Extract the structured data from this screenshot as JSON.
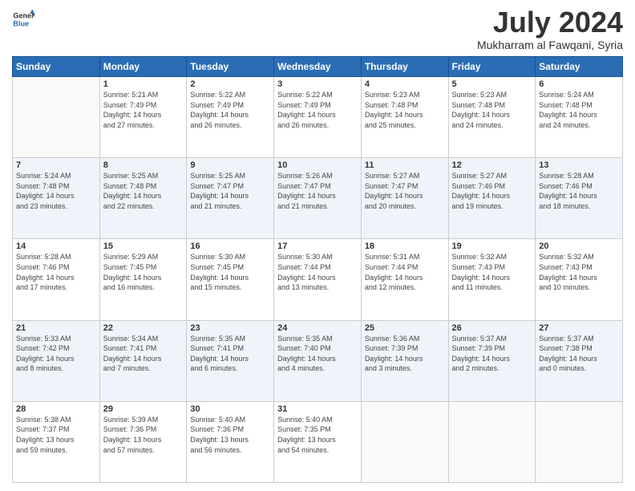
{
  "header": {
    "logo_line1": "General",
    "logo_line2": "Blue",
    "title": "July 2024",
    "subtitle": "Mukharram al Fawqani, Syria"
  },
  "weekdays": [
    "Sunday",
    "Monday",
    "Tuesday",
    "Wednesday",
    "Thursday",
    "Friday",
    "Saturday"
  ],
  "weeks": [
    [
      {
        "day": "",
        "info": ""
      },
      {
        "day": "1",
        "info": "Sunrise: 5:21 AM\nSunset: 7:49 PM\nDaylight: 14 hours\nand 27 minutes."
      },
      {
        "day": "2",
        "info": "Sunrise: 5:22 AM\nSunset: 7:49 PM\nDaylight: 14 hours\nand 26 minutes."
      },
      {
        "day": "3",
        "info": "Sunrise: 5:22 AM\nSunset: 7:49 PM\nDaylight: 14 hours\nand 26 minutes."
      },
      {
        "day": "4",
        "info": "Sunrise: 5:23 AM\nSunset: 7:48 PM\nDaylight: 14 hours\nand 25 minutes."
      },
      {
        "day": "5",
        "info": "Sunrise: 5:23 AM\nSunset: 7:48 PM\nDaylight: 14 hours\nand 24 minutes."
      },
      {
        "day": "6",
        "info": "Sunrise: 5:24 AM\nSunset: 7:48 PM\nDaylight: 14 hours\nand 24 minutes."
      }
    ],
    [
      {
        "day": "7",
        "info": "Sunrise: 5:24 AM\nSunset: 7:48 PM\nDaylight: 14 hours\nand 23 minutes."
      },
      {
        "day": "8",
        "info": "Sunrise: 5:25 AM\nSunset: 7:48 PM\nDaylight: 14 hours\nand 22 minutes."
      },
      {
        "day": "9",
        "info": "Sunrise: 5:25 AM\nSunset: 7:47 PM\nDaylight: 14 hours\nand 21 minutes."
      },
      {
        "day": "10",
        "info": "Sunrise: 5:26 AM\nSunset: 7:47 PM\nDaylight: 14 hours\nand 21 minutes."
      },
      {
        "day": "11",
        "info": "Sunrise: 5:27 AM\nSunset: 7:47 PM\nDaylight: 14 hours\nand 20 minutes."
      },
      {
        "day": "12",
        "info": "Sunrise: 5:27 AM\nSunset: 7:46 PM\nDaylight: 14 hours\nand 19 minutes."
      },
      {
        "day": "13",
        "info": "Sunrise: 5:28 AM\nSunset: 7:46 PM\nDaylight: 14 hours\nand 18 minutes."
      }
    ],
    [
      {
        "day": "14",
        "info": "Sunrise: 5:28 AM\nSunset: 7:46 PM\nDaylight: 14 hours\nand 17 minutes."
      },
      {
        "day": "15",
        "info": "Sunrise: 5:29 AM\nSunset: 7:45 PM\nDaylight: 14 hours\nand 16 minutes."
      },
      {
        "day": "16",
        "info": "Sunrise: 5:30 AM\nSunset: 7:45 PM\nDaylight: 14 hours\nand 15 minutes."
      },
      {
        "day": "17",
        "info": "Sunrise: 5:30 AM\nSunset: 7:44 PM\nDaylight: 14 hours\nand 13 minutes."
      },
      {
        "day": "18",
        "info": "Sunrise: 5:31 AM\nSunset: 7:44 PM\nDaylight: 14 hours\nand 12 minutes."
      },
      {
        "day": "19",
        "info": "Sunrise: 5:32 AM\nSunset: 7:43 PM\nDaylight: 14 hours\nand 11 minutes."
      },
      {
        "day": "20",
        "info": "Sunrise: 5:32 AM\nSunset: 7:43 PM\nDaylight: 14 hours\nand 10 minutes."
      }
    ],
    [
      {
        "day": "21",
        "info": "Sunrise: 5:33 AM\nSunset: 7:42 PM\nDaylight: 14 hours\nand 8 minutes."
      },
      {
        "day": "22",
        "info": "Sunrise: 5:34 AM\nSunset: 7:41 PM\nDaylight: 14 hours\nand 7 minutes."
      },
      {
        "day": "23",
        "info": "Sunrise: 5:35 AM\nSunset: 7:41 PM\nDaylight: 14 hours\nand 6 minutes."
      },
      {
        "day": "24",
        "info": "Sunrise: 5:35 AM\nSunset: 7:40 PM\nDaylight: 14 hours\nand 4 minutes."
      },
      {
        "day": "25",
        "info": "Sunrise: 5:36 AM\nSunset: 7:39 PM\nDaylight: 14 hours\nand 3 minutes."
      },
      {
        "day": "26",
        "info": "Sunrise: 5:37 AM\nSunset: 7:39 PM\nDaylight: 14 hours\nand 2 minutes."
      },
      {
        "day": "27",
        "info": "Sunrise: 5:37 AM\nSunset: 7:38 PM\nDaylight: 14 hours\nand 0 minutes."
      }
    ],
    [
      {
        "day": "28",
        "info": "Sunrise: 5:38 AM\nSunset: 7:37 PM\nDaylight: 13 hours\nand 59 minutes."
      },
      {
        "day": "29",
        "info": "Sunrise: 5:39 AM\nSunset: 7:36 PM\nDaylight: 13 hours\nand 57 minutes."
      },
      {
        "day": "30",
        "info": "Sunrise: 5:40 AM\nSunset: 7:36 PM\nDaylight: 13 hours\nand 56 minutes."
      },
      {
        "day": "31",
        "info": "Sunrise: 5:40 AM\nSunset: 7:35 PM\nDaylight: 13 hours\nand 54 minutes."
      },
      {
        "day": "",
        "info": ""
      },
      {
        "day": "",
        "info": ""
      },
      {
        "day": "",
        "info": ""
      }
    ]
  ]
}
